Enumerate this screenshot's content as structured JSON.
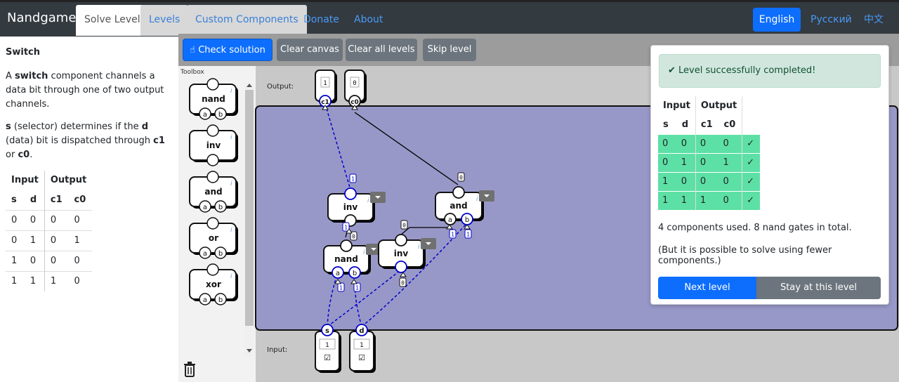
{
  "nav": {
    "brand": "Nandgame",
    "solve_level": "Solve Level",
    "levels": "Levels",
    "custom_components": "Custom Components",
    "donate": "Donate",
    "about": "About",
    "lang_english": "English",
    "lang_russian": "Русский",
    "lang_chinese": "中文"
  },
  "level": {
    "title": "Switch",
    "desc1_pre": "A ",
    "desc1_bold": "switch",
    "desc1_post": " component channels a data bit through one of two output channels.",
    "desc2_s": "s",
    "desc2_a": " (selector) determines if the ",
    "desc2_d": "d",
    "desc2_b": " (data) bit is dispatched through ",
    "desc2_c1": "c1",
    "desc2_or": " or ",
    "desc2_c0": "c0",
    "desc2_end": ".",
    "table": {
      "group_input": "Input",
      "group_output": "Output",
      "headers": [
        "s",
        "d",
        "c1",
        "c0"
      ],
      "rows": [
        [
          "0",
          "0",
          "0",
          "0"
        ],
        [
          "0",
          "1",
          "0",
          "1"
        ],
        [
          "1",
          "0",
          "0",
          "0"
        ],
        [
          "1",
          "1",
          "1",
          "0"
        ]
      ]
    }
  },
  "toolbar": {
    "check_solution": "Check solution",
    "clear_canvas": "Clear canvas",
    "clear_all_levels": "Clear all levels",
    "skip_level": "Skip level"
  },
  "toolbox": {
    "label": "Toolbox",
    "components": [
      "nand",
      "inv",
      "and",
      "or",
      "xor"
    ]
  },
  "canvas": {
    "output_label": "Output:",
    "input_label": "Input:",
    "outputs": [
      {
        "pin": "c1",
        "value": "1"
      },
      {
        "pin": "c0",
        "value": "0"
      }
    ],
    "inputs": [
      {
        "pin": "s",
        "value": "1",
        "checked": true
      },
      {
        "pin": "d",
        "value": "1",
        "checked": true
      }
    ],
    "gates": [
      {
        "id": "inv1",
        "label": "inv"
      },
      {
        "id": "and1",
        "label": "and"
      },
      {
        "id": "nand1",
        "label": "nand"
      },
      {
        "id": "inv2",
        "label": "inv"
      }
    ],
    "wire_labels": [
      "1",
      "0",
      "0",
      "0",
      "1",
      "1",
      "1",
      "1",
      "0",
      "1"
    ],
    "pin_a": "a",
    "pin_b": "b",
    "colors": {
      "canvas_board": "#9898c8",
      "active_wire": "#0000cc",
      "inactive_wire": "#000000"
    }
  },
  "result": {
    "success": "Level successfully completed!",
    "table": {
      "group_input": "Input",
      "group_output": "Output",
      "headers": [
        "s",
        "d",
        "c1",
        "c0"
      ],
      "rows": [
        [
          "0",
          "0",
          "0",
          "0",
          "✓"
        ],
        [
          "0",
          "1",
          "0",
          "1",
          "✓"
        ],
        [
          "1",
          "0",
          "0",
          "0",
          "✓"
        ],
        [
          "1",
          "1",
          "1",
          "0",
          "✓"
        ]
      ]
    },
    "info": "4 components used. 8 nand gates in total.",
    "hint": "(But it is possible to solve using fewer components.)",
    "next_level": "Next level",
    "stay": "Stay at this level"
  }
}
